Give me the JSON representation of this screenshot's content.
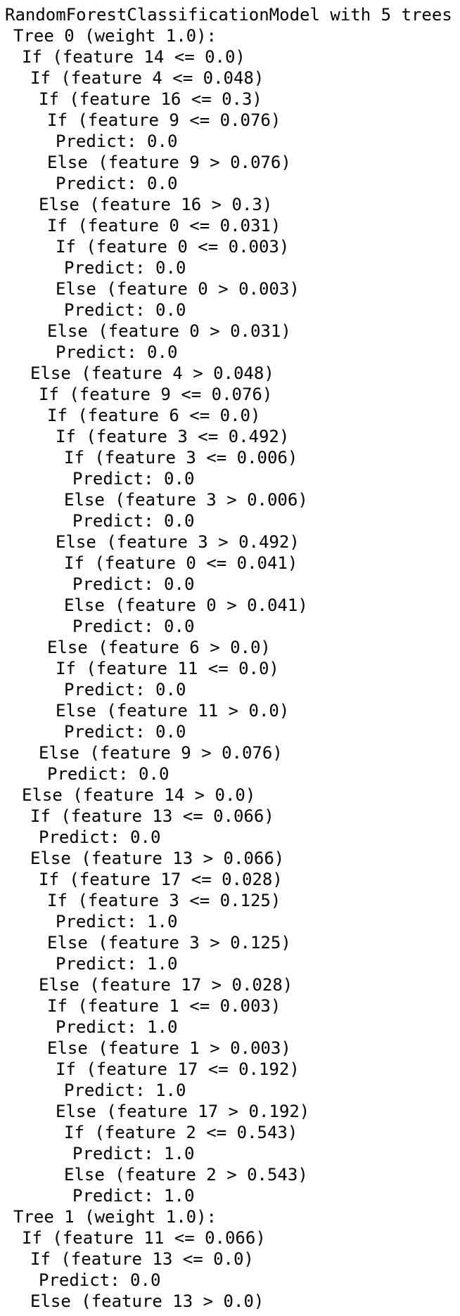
{
  "partial_top_line": {
    "text_before": "",
    "text_highlight": "",
    "text_after": ""
  },
  "model_header": "RandomForestClassificationModel with 5 trees",
  "lines": [
    {
      "indent": 1,
      "text": "Tree 0 (weight 1.0):"
    },
    {
      "indent": 2,
      "text": "If (feature 14 <= 0.0)"
    },
    {
      "indent": 3,
      "text": "If (feature 4 <= 0.048)"
    },
    {
      "indent": 4,
      "text": "If (feature 16 <= 0.3)"
    },
    {
      "indent": 5,
      "text": "If (feature 9 <= 0.076)"
    },
    {
      "indent": 6,
      "text": "Predict: 0.0"
    },
    {
      "indent": 5,
      "text": "Else (feature 9 > 0.076)"
    },
    {
      "indent": 6,
      "text": "Predict: 0.0"
    },
    {
      "indent": 4,
      "text": "Else (feature 16 > 0.3)"
    },
    {
      "indent": 5,
      "text": "If (feature 0 <= 0.031)"
    },
    {
      "indent": 6,
      "text": "If (feature 0 <= 0.003)"
    },
    {
      "indent": 7,
      "text": "Predict: 0.0"
    },
    {
      "indent": 6,
      "text": "Else (feature 0 > 0.003)"
    },
    {
      "indent": 7,
      "text": "Predict: 0.0"
    },
    {
      "indent": 5,
      "text": "Else (feature 0 > 0.031)"
    },
    {
      "indent": 6,
      "text": "Predict: 0.0"
    },
    {
      "indent": 3,
      "text": "Else (feature 4 > 0.048)"
    },
    {
      "indent": 4,
      "text": "If (feature 9 <= 0.076)"
    },
    {
      "indent": 5,
      "text": "If (feature 6 <= 0.0)"
    },
    {
      "indent": 6,
      "text": "If (feature 3 <= 0.492)"
    },
    {
      "indent": 7,
      "text": "If (feature 3 <= 0.006)"
    },
    {
      "indent": 8,
      "text": "Predict: 0.0"
    },
    {
      "indent": 7,
      "text": "Else (feature 3 > 0.006)"
    },
    {
      "indent": 8,
      "text": "Predict: 0.0"
    },
    {
      "indent": 6,
      "text": "Else (feature 3 > 0.492)"
    },
    {
      "indent": 7,
      "text": "If (feature 0 <= 0.041)"
    },
    {
      "indent": 8,
      "text": "Predict: 0.0"
    },
    {
      "indent": 7,
      "text": "Else (feature 0 > 0.041)"
    },
    {
      "indent": 8,
      "text": "Predict: 0.0"
    },
    {
      "indent": 5,
      "text": "Else (feature 6 > 0.0)"
    },
    {
      "indent": 6,
      "text": "If (feature 11 <= 0.0)"
    },
    {
      "indent": 7,
      "text": "Predict: 0.0"
    },
    {
      "indent": 6,
      "text": "Else (feature 11 > 0.0)"
    },
    {
      "indent": 7,
      "text": "Predict: 0.0"
    },
    {
      "indent": 4,
      "text": "Else (feature 9 > 0.076)"
    },
    {
      "indent": 5,
      "text": "Predict: 0.0"
    },
    {
      "indent": 2,
      "text": "Else (feature 14 > 0.0)"
    },
    {
      "indent": 3,
      "text": "If (feature 13 <= 0.066)"
    },
    {
      "indent": 4,
      "text": "Predict: 0.0"
    },
    {
      "indent": 3,
      "text": "Else (feature 13 > 0.066)"
    },
    {
      "indent": 4,
      "text": "If (feature 17 <= 0.028)"
    },
    {
      "indent": 5,
      "text": "If (feature 3 <= 0.125)"
    },
    {
      "indent": 6,
      "text": "Predict: 1.0"
    },
    {
      "indent": 5,
      "text": "Else (feature 3 > 0.125)"
    },
    {
      "indent": 6,
      "text": "Predict: 1.0"
    },
    {
      "indent": 4,
      "text": "Else (feature 17 > 0.028)"
    },
    {
      "indent": 5,
      "text": "If (feature 1 <= 0.003)"
    },
    {
      "indent": 6,
      "text": "Predict: 1.0"
    },
    {
      "indent": 5,
      "text": "Else (feature 1 > 0.003)"
    },
    {
      "indent": 6,
      "text": "If (feature 17 <= 0.192)"
    },
    {
      "indent": 7,
      "text": "Predict: 1.0"
    },
    {
      "indent": 6,
      "text": "Else (feature 17 > 0.192)"
    },
    {
      "indent": 7,
      "text": "If (feature 2 <= 0.543)"
    },
    {
      "indent": 8,
      "text": "Predict: 1.0"
    },
    {
      "indent": 7,
      "text": "Else (feature 2 > 0.543)"
    },
    {
      "indent": 8,
      "text": "Predict: 1.0"
    },
    {
      "indent": 1,
      "text": "Tree 1 (weight 1.0):"
    },
    {
      "indent": 2,
      "text": "If (feature 11 <= 0.066)"
    },
    {
      "indent": 3,
      "text": "If (feature 13 <= 0.0)"
    },
    {
      "indent": 4,
      "text": "Predict: 0.0"
    },
    {
      "indent": 3,
      "text": "Else (feature 13 > 0.0)"
    }
  ]
}
